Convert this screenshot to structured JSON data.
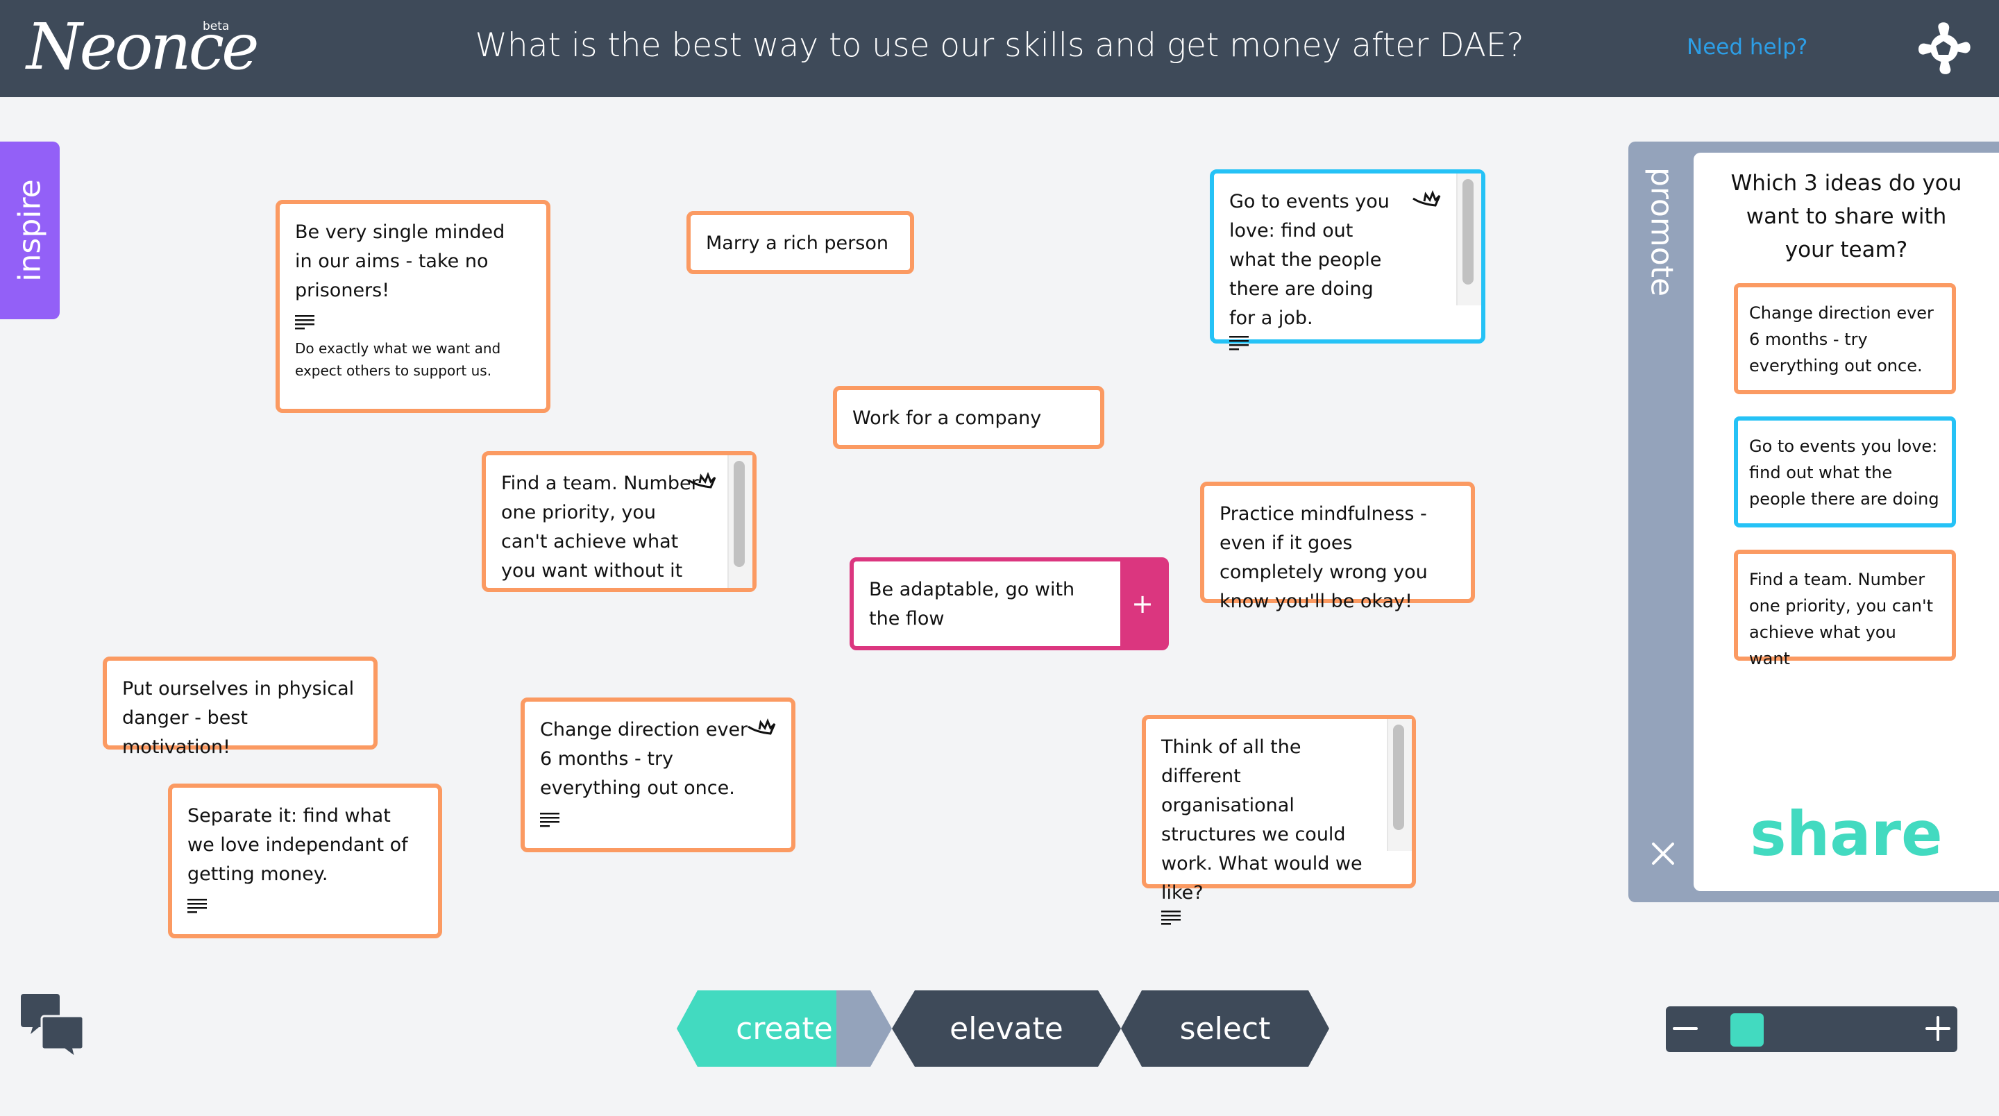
{
  "header": {
    "logo": "Neonce",
    "badge": "beta",
    "title": "What is the best way to use our skills and get money after DAE?",
    "help_link": "Need help?",
    "settings_icon": "gear-icon"
  },
  "inspire_tab": {
    "label": "inspire"
  },
  "colors": {
    "header_bg": "#3e4a59",
    "card_orange": "#fb9a62",
    "card_blue": "#25c2f6",
    "card_pink": "#db367f",
    "accent_teal": "#42dac0",
    "inspire_purple": "#9360f7",
    "panel_gray": "#94a3bb",
    "link_blue": "#2d9ee6"
  },
  "cards": [
    {
      "text": "Be very single minded in our aims - take no prisoners!",
      "description": "Do exactly what we want and expect others to support us.",
      "has_notes": true,
      "crowned": false,
      "color": "orange"
    },
    {
      "text": "Marry a rich person",
      "color": "orange"
    },
    {
      "text": "Go to events you love: find out what the people there are doing for a job.",
      "has_notes": true,
      "crowned": true,
      "color": "blue"
    },
    {
      "text": "Work for a company",
      "color": "orange"
    },
    {
      "text": "Find a team. Number one priority, you can't achieve what you want without it",
      "crowned": true,
      "color": "orange"
    },
    {
      "text": "Practice mindfulness - even if it goes completely wrong you know you'll be okay!",
      "color": "orange"
    },
    {
      "text": "Be adaptable, go with the flow",
      "color": "pink",
      "action": "+"
    },
    {
      "text": "Put ourselves in physical danger - best motivation!",
      "color": "orange"
    },
    {
      "text": "Change direction ever 6 months - try everything out once.",
      "has_notes": true,
      "crowned": true,
      "color": "orange"
    },
    {
      "text": "Think of all the different organisational structures we could work. What would we like?",
      "has_notes": true,
      "color": "orange"
    },
    {
      "text": "Separate it: find what we love independant of getting money.",
      "has_notes": true,
      "color": "orange"
    }
  ],
  "promote_panel": {
    "label": "promote",
    "question": "Which 3 ideas do you want to share with your team?",
    "selected": [
      {
        "text": "Change direction ever 6 months - try everything out once.",
        "color": "orange"
      },
      {
        "text": "Go to events you love: find out what the people there are doing",
        "color": "blue"
      },
      {
        "text": "Find a team. Number one priority, you can't achieve what you want",
        "color": "orange"
      }
    ],
    "share_label": "share",
    "close_icon": "close-icon"
  },
  "stages": {
    "create": "create",
    "elevate": "elevate",
    "select": "select",
    "active": "create"
  },
  "zoom": {
    "minus": "−",
    "plus": "+",
    "level_fraction": 0.1
  }
}
